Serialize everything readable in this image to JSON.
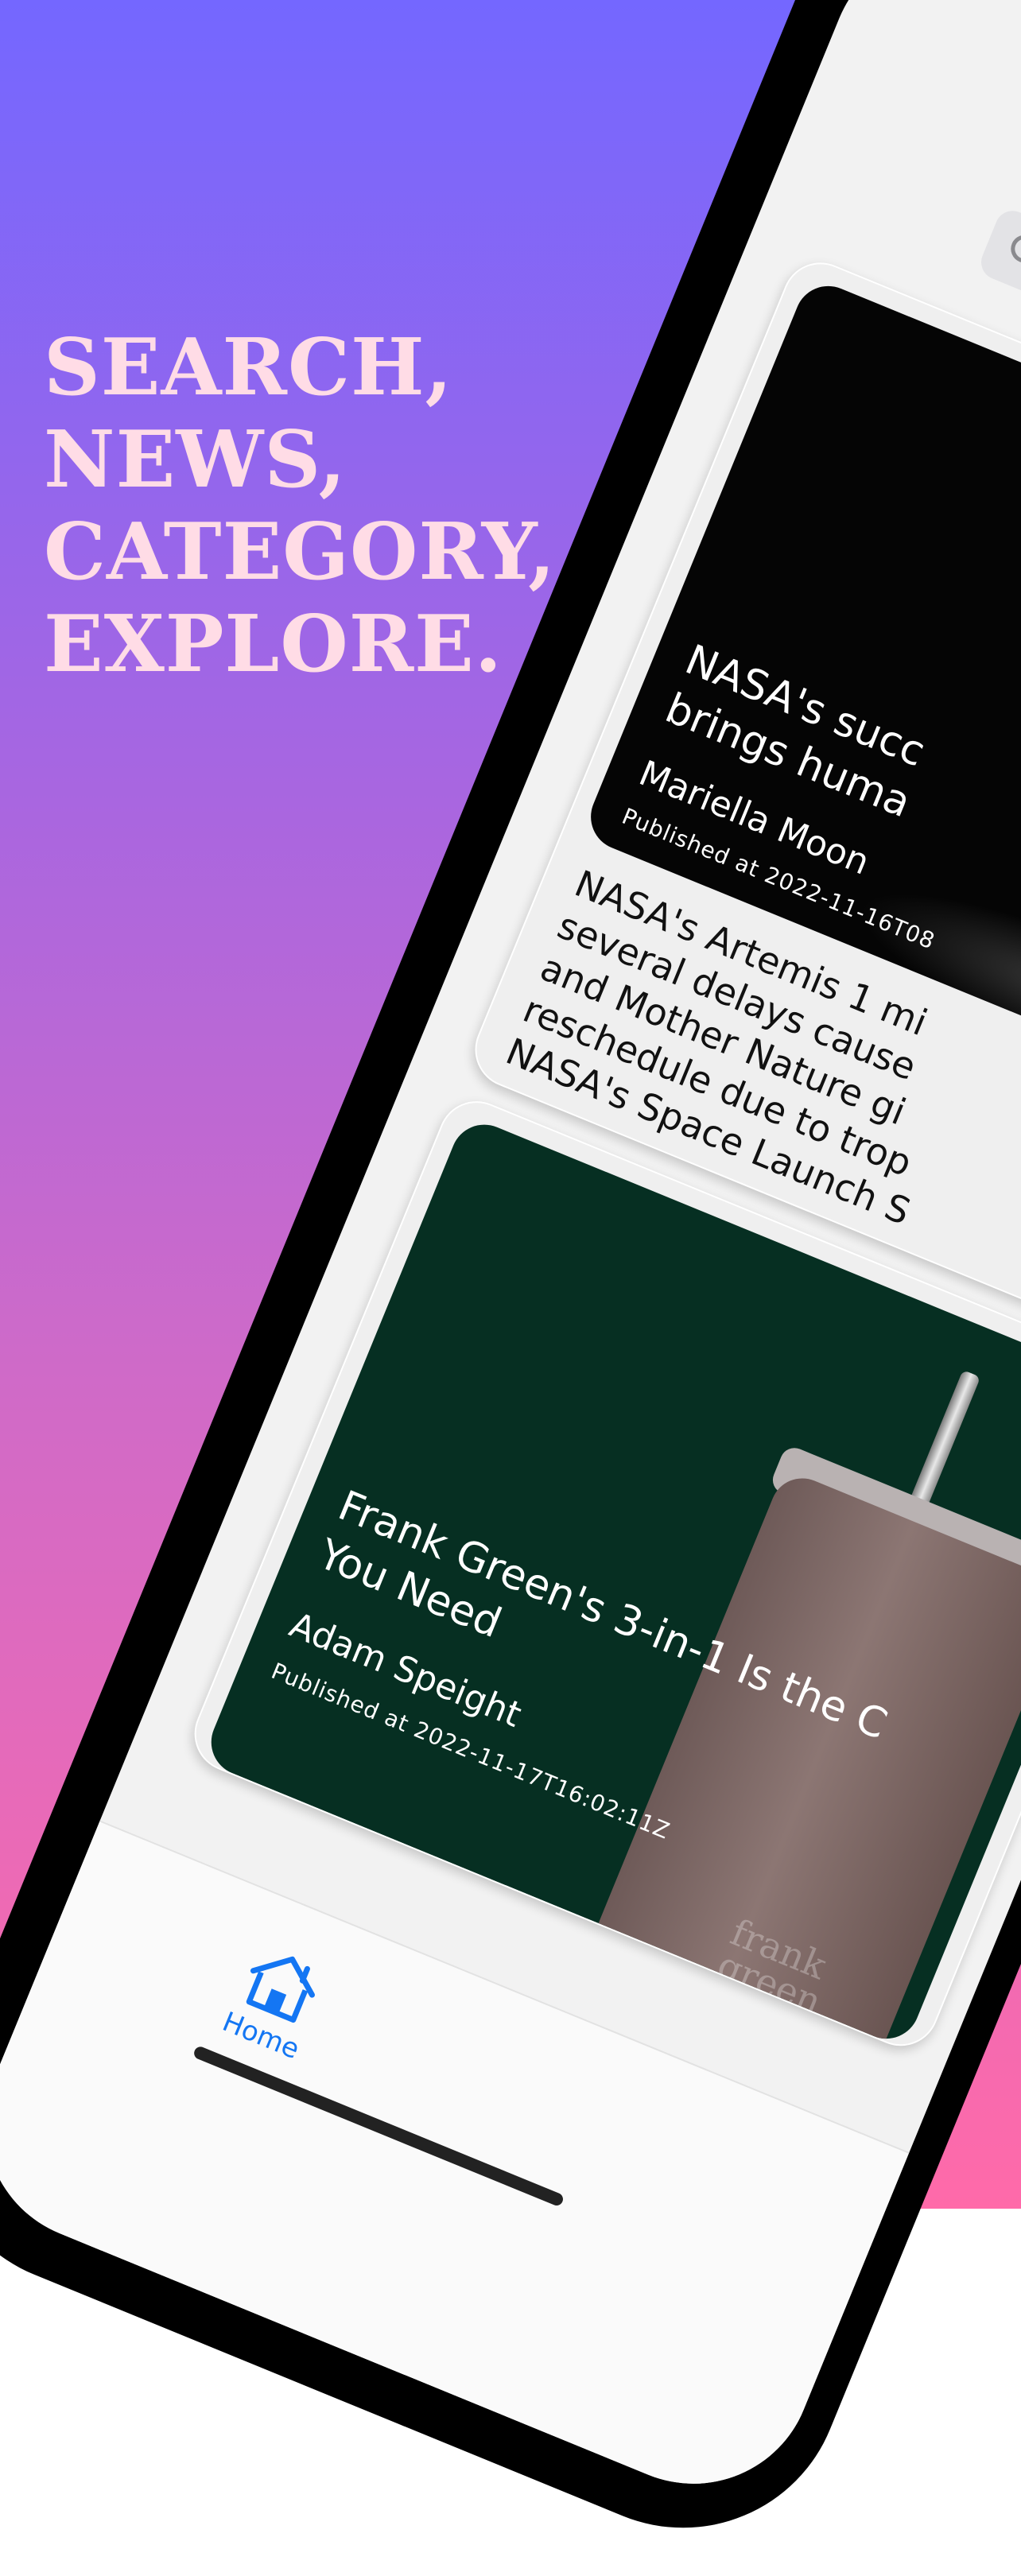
{
  "headline": {
    "lines": [
      "SEARCH,",
      "NEWS,",
      "CATEGORY,",
      "EXPLORE."
    ]
  },
  "colors": {
    "gradient_top": "#7467FF",
    "gradient_bottom": "#FF6AA9",
    "headline": "#FFDCE6",
    "tab_active": "#1476F3"
  },
  "search": {
    "icon": "search-icon"
  },
  "articles": [
    {
      "title": "NASA's succ\nbrings huma",
      "author": "Mariella Moon",
      "published": "Published at 2022-11-16T08",
      "description": "NASA's Artemis 1 mi\nseveral delays cause\nand Mother Nature gi\nreschedule due to trop\nNASA's Space Launch S"
    },
    {
      "title": "Frank Green's 3-in-1 Is the C\nYou Need",
      "author": "Adam Speight",
      "published": "Published at 2022-11-17T16:02:11Z",
      "image_brand": "frank\ngreen"
    }
  ],
  "tabbar": {
    "home_label": "Home",
    "home_icon": "house-icon"
  }
}
